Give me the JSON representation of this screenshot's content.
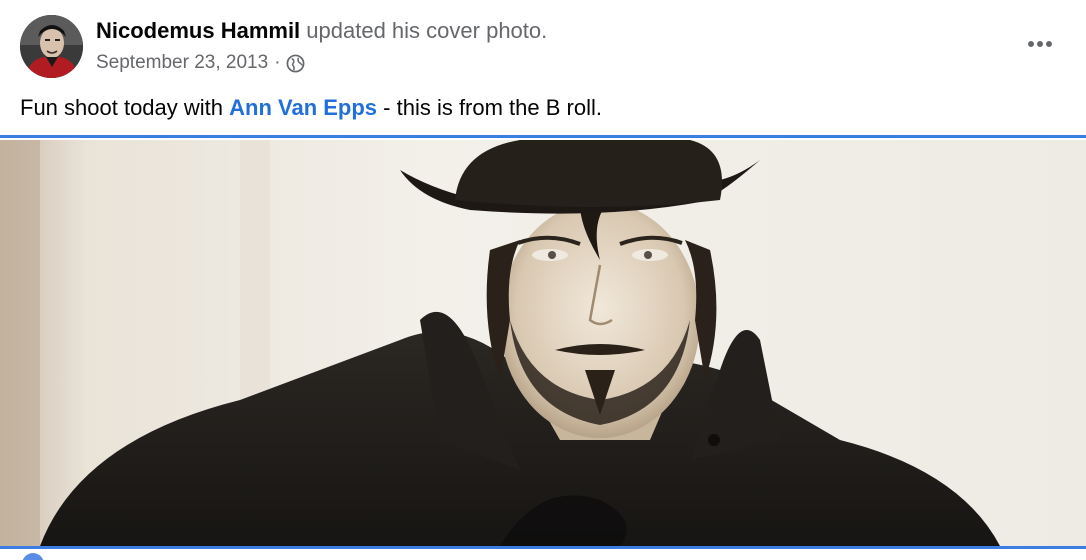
{
  "post": {
    "author": "Nicodemus Hammil",
    "action": "updated his cover photo.",
    "date": "September 23, 2013",
    "separator": "·",
    "privacy_icon": "globe-icon",
    "more_icon": "more-options-icon",
    "caption": {
      "before": "Fun shoot today with ",
      "mention": "Ann Van Epps",
      "after": " - this is from the B roll."
    },
    "photo_icon": "cover-photo"
  },
  "colors": {
    "text": "#050505",
    "secondary": "#65676b",
    "link": "#216fdb",
    "divider": "#3b7de2"
  }
}
